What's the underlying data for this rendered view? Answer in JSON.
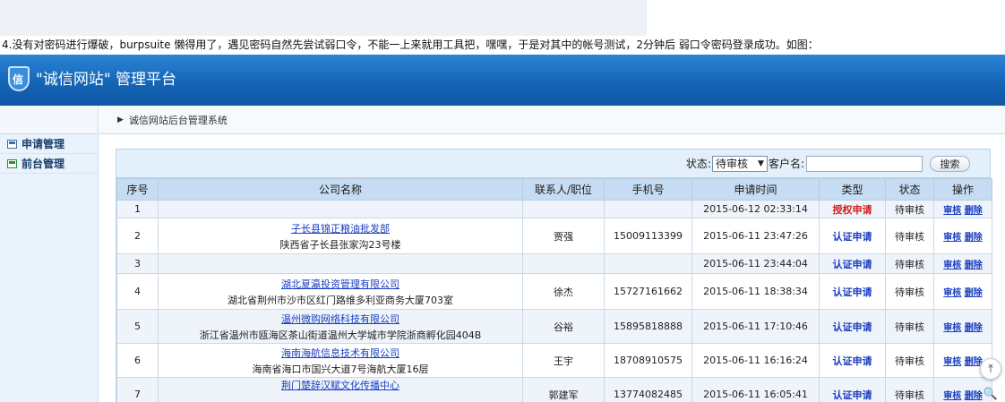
{
  "caption": "4.没有对密码进行爆破，burpsuite 懒得用了，遇见密码自然先尝试弱口令，不能一上来就用工具把，嘿嘿，于是对其中的帐号测试，2分钟后 弱口令密码登录成功。如图：",
  "app": {
    "logo_text": "信",
    "title": "\"诚信网站\" 管理平台"
  },
  "sidebar": {
    "items": [
      {
        "label": "申请管理",
        "icon": "form-icon"
      },
      {
        "label": "前台管理",
        "icon": "window-icon"
      }
    ]
  },
  "breadcrumb": "诚信网站后台管理系统",
  "filter": {
    "status_label": "状态:",
    "status_value": "待审核",
    "customer_label": "客户名:",
    "customer_value": "",
    "search_label": "搜索"
  },
  "table": {
    "headers": [
      "序号",
      "公司名称",
      "联系人/职位",
      "手机号",
      "申请时间",
      "类型",
      "状态",
      "操作"
    ],
    "rows": [
      {
        "no": "1",
        "company": "",
        "address": "",
        "contact": "",
        "phone": "",
        "time": "2015-06-12 02:33:14",
        "type": "授权申请",
        "status": "待审核"
      },
      {
        "no": "2",
        "company": "子长县锦正粮油批发部",
        "address": "陕西省子长县张家沟23号楼",
        "contact": "贾强",
        "phone": "15009113399",
        "time": "2015-06-11 23:47:26",
        "type": "认证申请",
        "status": "待审核"
      },
      {
        "no": "3",
        "company": "",
        "address": "",
        "contact": "",
        "phone": "",
        "time": "2015-06-11 23:44:04",
        "type": "认证申请",
        "status": "待审核"
      },
      {
        "no": "4",
        "company": "湖北夏瀛投资管理有限公司",
        "address": "湖北省荆州市沙市区红门路维多利亚商务大厦703室",
        "contact": "徐杰",
        "phone": "15727161662",
        "time": "2015-06-11 18:38:34",
        "type": "认证申请",
        "status": "待审核"
      },
      {
        "no": "5",
        "company": "温州微购网络科技有限公司",
        "address": "浙江省温州市瓯海区茶山街道温州大学城市学院浙商孵化园404B",
        "contact": "谷裕",
        "phone": "15895818888",
        "time": "2015-06-11 17:10:46",
        "type": "认证申请",
        "status": "待审核"
      },
      {
        "no": "6",
        "company": "海南海航信息技术有限公司",
        "address": "海南省海口市国兴大道7号海航大厦16层",
        "contact": "王宇",
        "phone": "18708910575",
        "time": "2015-06-11 16:16:24",
        "type": "认证申请",
        "status": "待审核"
      },
      {
        "no": "7",
        "company": "荆门楚辞汉赋文化传播中心",
        "address": "",
        "contact": "郭建军",
        "phone": "13774082485",
        "time": "2015-06-11 16:05:41",
        "type": "认证申请",
        "status": "待审核"
      }
    ],
    "op_review": "审核",
    "op_delete": "删除"
  }
}
